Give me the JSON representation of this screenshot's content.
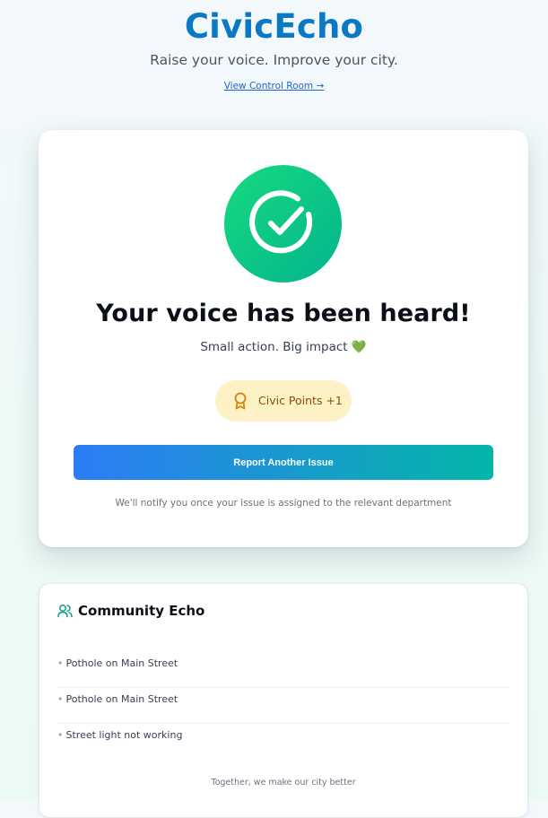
{
  "header": {
    "brand": "CivicEcho",
    "tagline": "Raise your voice. Improve your city.",
    "control_room_link": "View Control Room →"
  },
  "success": {
    "icon": "check-circle-icon",
    "title": "Your voice has been heard!",
    "subtitle": "Small action. Big impact",
    "subtitle_emoji": "💚",
    "points_icon": "award-icon",
    "points_label": "Civic Points +1",
    "report_button": "Report Another Issue",
    "notify_text": "We'll notify you once your issue is assigned to the relevant department"
  },
  "community": {
    "icon": "users-icon",
    "title": "Community Echo",
    "items": [
      {
        "text": "Pothole on Main Street"
      },
      {
        "text": "Pothole on Main Street"
      },
      {
        "text": "Street light not working"
      }
    ],
    "footer": "Together, we make our city better"
  },
  "colors": {
    "brand": "#0a78c2",
    "success_gradient_start": "#16da7e",
    "success_gradient_end": "#04b48e",
    "points_bg": "#fdf2c5",
    "points_text": "#8a4b0b",
    "button_gradient_start": "#2d7cf6",
    "button_gradient_end": "#04b6a8",
    "accent_teal": "#0f9d8a"
  }
}
